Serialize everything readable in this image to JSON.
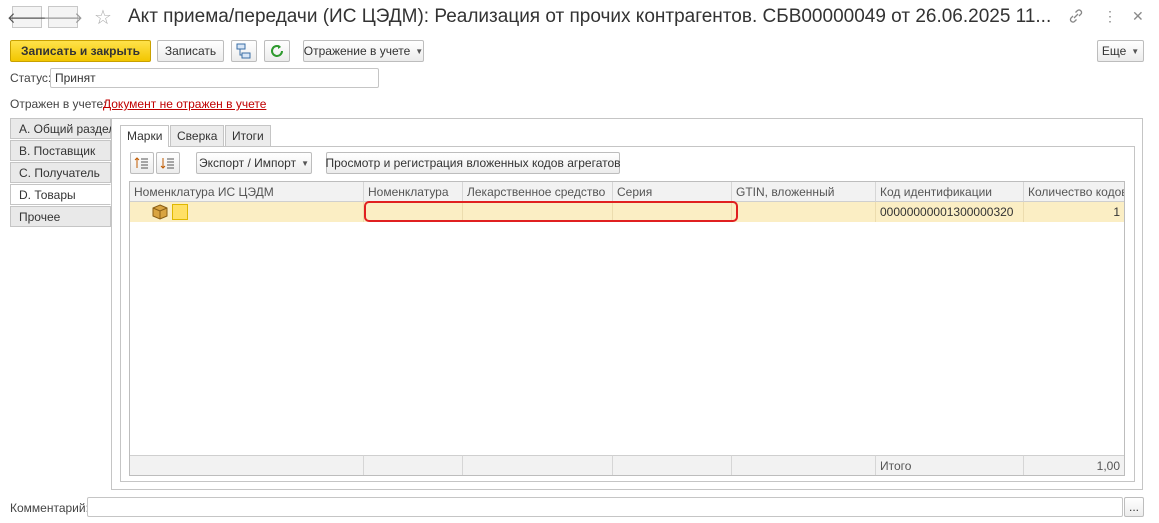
{
  "window": {
    "title": "Акт приема/передачи (ИС ЦЭДМ): Реализация от прочих контрагентов.  СБВ00000049 от 26.06.2025 11...",
    "back_icon": "arrow-left",
    "forward_icon": "arrow-right",
    "favorite_icon": "star",
    "link_icon": "chain-link",
    "menu_icon": "vertical-dots",
    "close_icon": "cross"
  },
  "toolbar": {
    "save_close_label": "Записать и закрыть",
    "save_label": "Записать",
    "structure_icon": "hierarchy",
    "refresh_icon": "refresh",
    "reflection_label": "Отражение в учете",
    "more_label": "Еще"
  },
  "status": {
    "label": "Статус:",
    "value": "Принят"
  },
  "reflected": {
    "label": "Отражен в учете:",
    "link": "Документ не отражен в учете"
  },
  "left_tabs": [
    "А. Общий раздел",
    "B. Поставщик",
    "C. Получатель",
    "D. Товары",
    "Прочее"
  ],
  "left_active": "D. Товары",
  "top_tabs": [
    "Марки",
    "Сверка",
    "Итоги"
  ],
  "top_active": "Марки",
  "grid_toolbar": {
    "sort_asc_icon": "sort-asc",
    "sort_desc_icon": "sort-desc",
    "export_label": "Экспорт / Импорт",
    "view_codes_label": "Просмотр и регистрация вложенных кодов агрегатов"
  },
  "table": {
    "columns": [
      "Номенклатура ИС ЦЭДМ",
      "Номенклатура",
      "Лекарственное средство",
      "Серия",
      "GTIN, вложенный",
      "Код идентификации",
      "Количество кодов"
    ],
    "rows": [
      {
        "nomenclature_icon": "package",
        "nomenclature": "",
        "drug": "",
        "series": "",
        "gtin": "",
        "code": "00000000001300000320",
        "count": "1"
      }
    ],
    "footer": {
      "label": "Итого",
      "total": "1,00"
    }
  },
  "comment": {
    "label": "Комментарий:",
    "value": "",
    "button": "..."
  }
}
